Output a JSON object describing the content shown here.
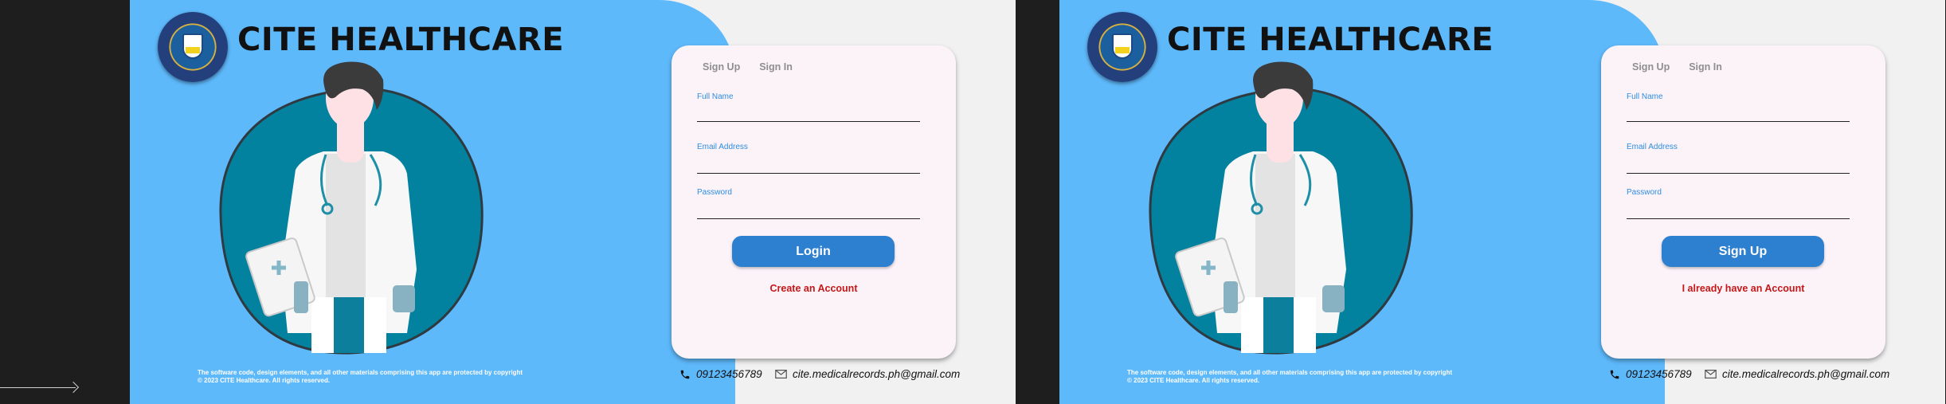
{
  "frames": [
    {
      "brand": "CITE HEALTHCARE",
      "tabs": [
        "Sign Up",
        "Sign In"
      ],
      "fields": [
        {
          "label": "Full Name",
          "value": ""
        },
        {
          "label": "Email Address",
          "value": ""
        },
        {
          "label": "Password",
          "value": ""
        }
      ],
      "primary_button": "Login",
      "secondary_link": "Create an Account",
      "copyright_line1": "The software code, design elements, and all other materials comprising this app are protected by copyright",
      "copyright_line2": "© 2023 CITE Healthcare. All rights reserved.",
      "phone": "09123456789",
      "email": "cite.medicalrecords.ph@gmail.com"
    },
    {
      "brand": "CITE HEALTHCARE",
      "tabs": [
        "Sign Up",
        "Sign In"
      ],
      "fields": [
        {
          "label": "Full Name",
          "value": ""
        },
        {
          "label": "Email Address",
          "value": ""
        },
        {
          "label": "Password",
          "value": ""
        }
      ],
      "primary_button": "Sign Up",
      "secondary_link": "I already have an Account",
      "copyright_line1": "The software code, design elements, and all other materials comprising this app are protected by copyright",
      "copyright_line2": "© 2023 CITE Healthcare. All rights reserved.",
      "phone": "09123456789",
      "email": "cite.medicalrecords.ph@gmail.com"
    }
  ],
  "icons": {
    "seal": "institution-seal-icon",
    "phone": "phone-icon",
    "email": "envelope-icon",
    "illustration": "doctor-illustration"
  },
  "colors": {
    "left_panel": "#5eb9fb",
    "right_bg": "#f1f1f1",
    "card": "#fbf3f8",
    "accent_button": "#2d7fd0",
    "field_label": "#2e8de0",
    "link": "#c41818",
    "teal_circle": "#03829f"
  }
}
